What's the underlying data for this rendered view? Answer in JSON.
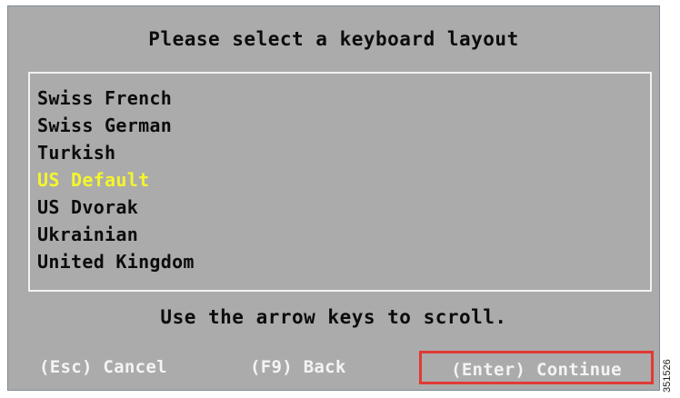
{
  "dialog": {
    "title": "Please select a keyboard layout",
    "hint": "Use the arrow keys to scroll.",
    "selected_color": "#f5f52c",
    "background_color": "#ababab"
  },
  "layouts": [
    {
      "label": "Swiss French",
      "selected": false
    },
    {
      "label": "Swiss German",
      "selected": false
    },
    {
      "label": "Turkish",
      "selected": false
    },
    {
      "label": "US Default",
      "selected": true
    },
    {
      "label": "US Dvorak",
      "selected": false
    },
    {
      "label": "Ukrainian",
      "selected": false
    },
    {
      "label": "United Kingdom",
      "selected": false
    }
  ],
  "actions": {
    "cancel": "(Esc) Cancel",
    "back": "(F9) Back",
    "continue": "(Enter) Continue",
    "highlight_color": "#e03a34"
  },
  "figure_id": "351526"
}
